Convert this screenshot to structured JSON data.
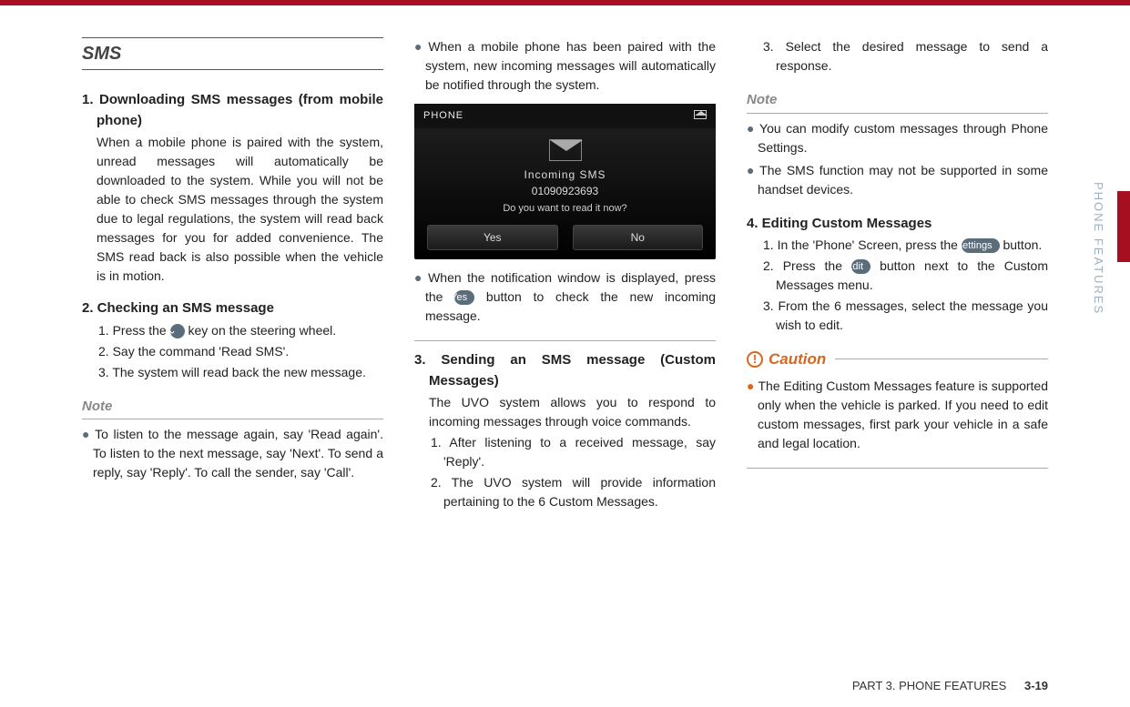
{
  "header_bar": "",
  "side": {
    "vertical_label": "PHONE FEATURES"
  },
  "footer": {
    "part": "PART 3. PHONE FEATURES",
    "page": "3-19"
  },
  "buttons": {
    "voice": "🎤",
    "yes": "Yes",
    "settings": "Settings",
    "edit": "Edit"
  },
  "col1": {
    "section": "SMS",
    "h1": "1. Downloading SMS messages (from mobile phone)",
    "p1": "When a mobile phone is paired with the system, unread messages will automatically be downloaded to the system. While you will not be able to check SMS messages through the system due to legal regulations, the system will read back messages for you for added convenience. The SMS read back is also possible when the vehicle is in motion.",
    "h2": "2. Checking an SMS message",
    "h2_s1a": "1. Press the ",
    "h2_s1b": " key on the steering wheel.",
    "h2_s2": "2. Say the command 'Read SMS'.",
    "h2_s3": "3. The system will read back the new message.",
    "note": "Note",
    "note_b1": "To listen to the message again, say 'Read again'. To listen to the next message, say 'Next'. To send a reply, say 'Reply'. To call the sender, say 'Call'."
  },
  "col2": {
    "b1": "When a mobile phone has been paired with the system, new incoming messages will automatically be notified through the system.",
    "sc": {
      "top_label": "PHONE",
      "line1": "Incoming SMS",
      "line2": "01090923693",
      "line3": "Do you want to read it now?",
      "btn_yes": "Yes",
      "btn_no": "No"
    },
    "b2a": "When the notification window is displayed, press the ",
    "b2b": " button to check the new incoming message.",
    "h3": "3. Sending an SMS message (Custom Messages)",
    "h3_p": "The UVO system allows you to respond to incoming messages through voice commands.",
    "h3_s1": "1. After listening to a received message, say 'Reply'.",
    "h3_s2": "2. The UVO system will provide information pertaining to the 6 Custom Messages."
  },
  "col3": {
    "s3": "3. Select the desired message to send a response.",
    "note": "Note",
    "note_b1": "You can modify custom messages through Phone Settings.",
    "note_b2": "The SMS function may not be supported in some handset devices.",
    "h4": "4. Editing Custom Messages",
    "h4_s1a": "1. In the 'Phone' Screen, press the ",
    "h4_s1b": " button.",
    "h4_s2a": "2. Press the ",
    "h4_s2b": " button next to the Custom Messages menu.",
    "h4_s3": "3. From the 6 messages, select the message you wish to edit.",
    "caution": "Caution",
    "caution_b1": "The Editing Custom Messages feature is supported only when the vehicle is parked. If you need to edit custom messages, first park your vehicle in a safe and legal location."
  }
}
